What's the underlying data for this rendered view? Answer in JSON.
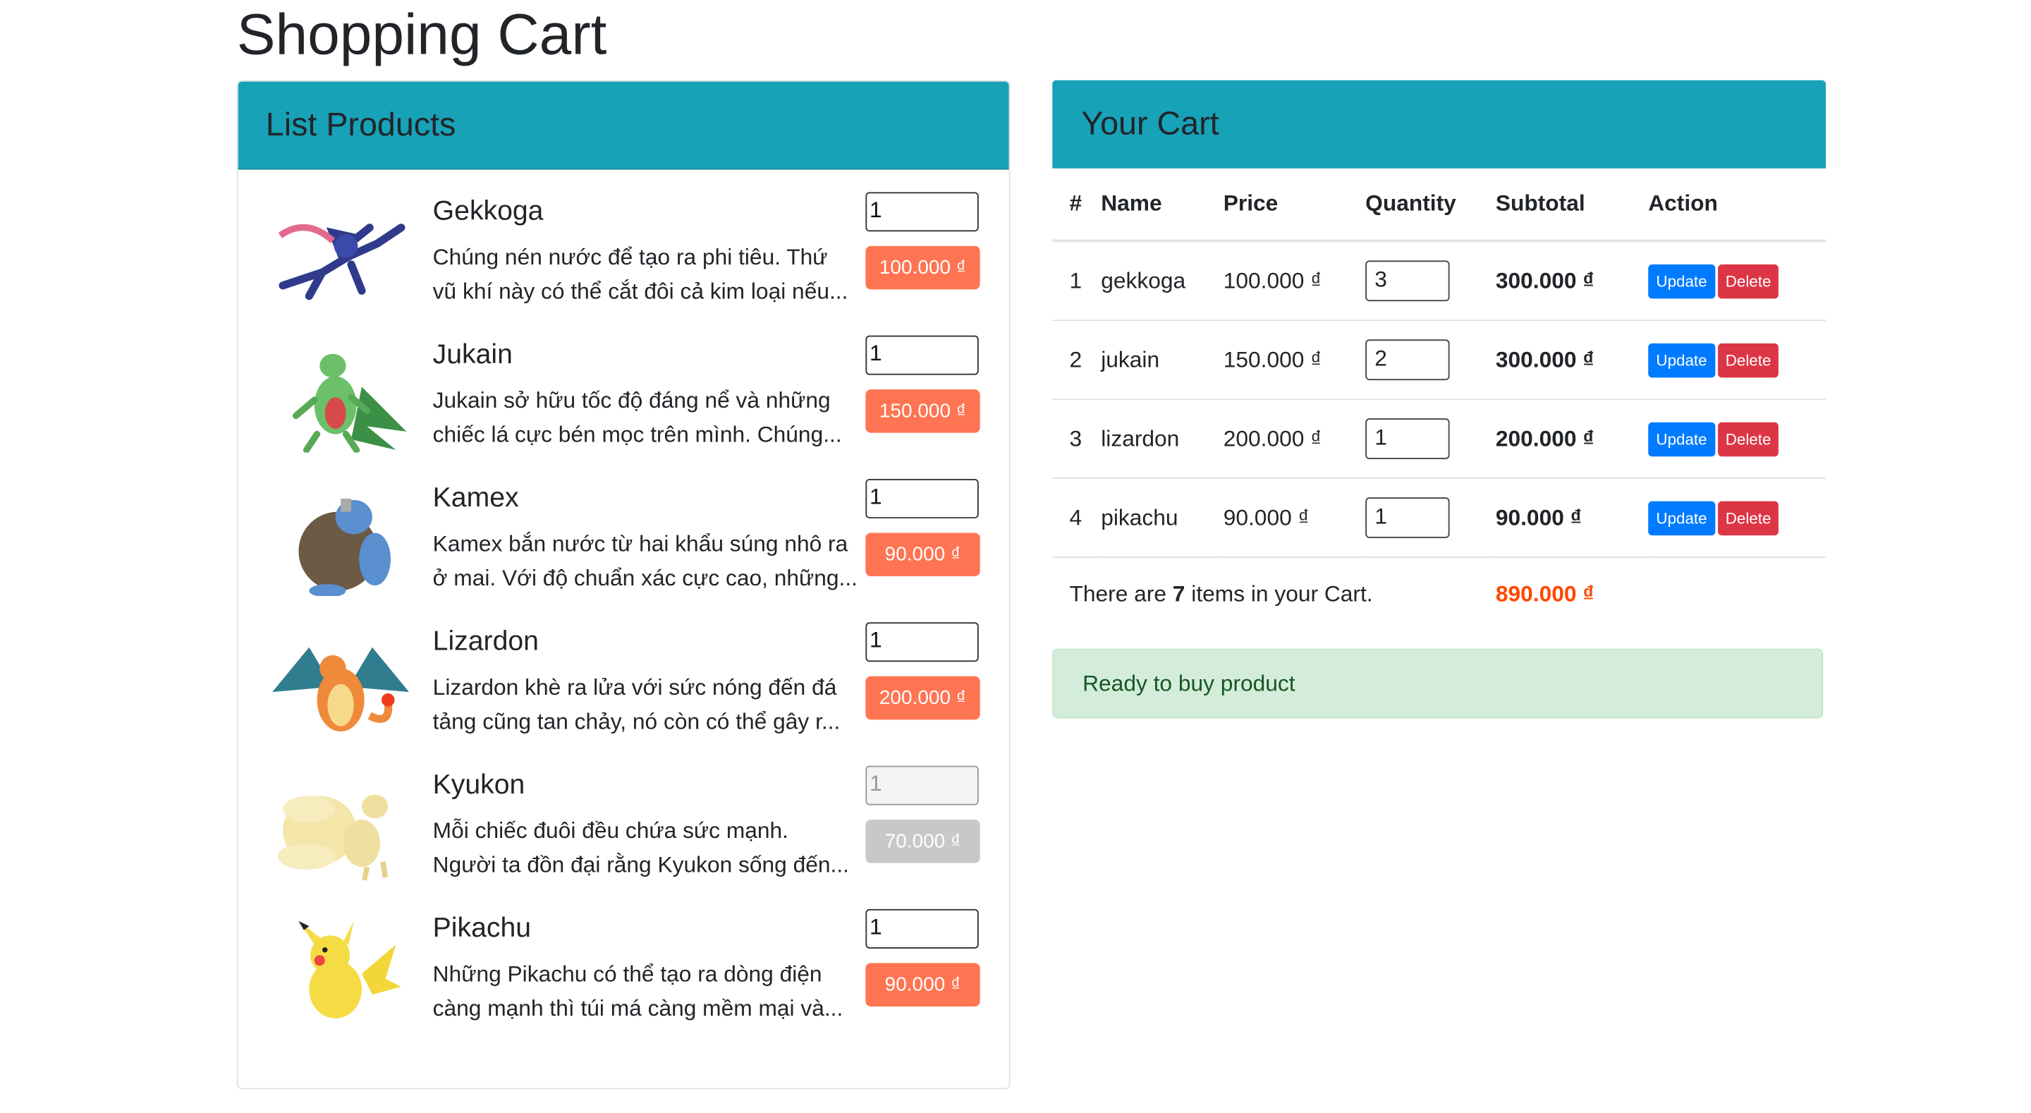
{
  "page": {
    "title": "Shopping Cart"
  },
  "products_panel": {
    "title": "List Products",
    "items": [
      {
        "name": "Gekkoga",
        "desc1": "Chúng nén nước để tạo ra phi tiêu. Thứ",
        "desc2": "vũ khí này có thể cắt đôi cả kim loại nếu...",
        "qty": "1",
        "price": "100.000 ₫",
        "image": "gekkoga-image"
      },
      {
        "name": "Jukain",
        "desc1": "Jukain sở hữu tốc độ đáng nể và những",
        "desc2": "chiếc lá cực bén mọc trên mình. Chúng...",
        "qty": "1",
        "price": "150.000 ₫",
        "image": "jukain-image"
      },
      {
        "name": "Kamex",
        "desc1": "Kamex bắn nước từ hai khẩu súng nhô ra",
        "desc2": "ở mai. Với độ chuẩn xác cực cao, những...",
        "qty": "1",
        "price": "90.000 ₫",
        "image": "kamex-image"
      },
      {
        "name": "Lizardon",
        "desc1": "Lizardon khè ra lửa với sức nóng đến đá",
        "desc2": "tảng cũng tan chảy, nó còn có thể gây r...",
        "qty": "1",
        "price": "200.000 ₫",
        "image": "lizardon-image"
      },
      {
        "name": "Kyukon",
        "desc1": "Mỗi chiếc đuôi đều chứa sức mạnh.",
        "desc2": "Người ta đồn đại rằng Kyukon sống đến...",
        "qty": "1",
        "price": "70.000 ₫",
        "image": "kyukon-image",
        "disabled": true
      },
      {
        "name": "Pikachu",
        "desc1": "Những Pikachu có thể tạo ra dòng điện",
        "desc2": "càng mạnh thì túi má càng mềm mại và...",
        "qty": "1",
        "price": "90.000 ₫",
        "image": "pikachu-image"
      }
    ]
  },
  "cart_panel": {
    "title": "Your Cart",
    "headers": [
      "#",
      "Name",
      "Price",
      "Quantity",
      "Subtotal",
      "Action"
    ],
    "rows": [
      {
        "num": "1",
        "name": "gekkoga",
        "price": "100.000 ₫",
        "qty": "3",
        "subtotal": "300.000 ₫"
      },
      {
        "num": "2",
        "name": "jukain",
        "price": "150.000 ₫",
        "qty": "2",
        "subtotal": "300.000 ₫"
      },
      {
        "num": "3",
        "name": "lizardon",
        "price": "200.000 ₫",
        "qty": "1",
        "subtotal": "200.000 ₫"
      },
      {
        "num": "4",
        "name": "pikachu",
        "price": "90.000 ₫",
        "qty": "1",
        "subtotal": "90.000 ₫"
      }
    ],
    "update_label": "Update",
    "delete_label": "Delete",
    "summary_prefix": "There are",
    "summary_count": "7",
    "summary_suffix": "items in your Cart.",
    "total": "890.000 ₫"
  },
  "alert": {
    "text": "Ready to buy product"
  },
  "colors": {
    "header": "#17a2b8",
    "price_badge": "#ff7452",
    "total": "#ff4800",
    "alert_bg": "#d4edda"
  }
}
